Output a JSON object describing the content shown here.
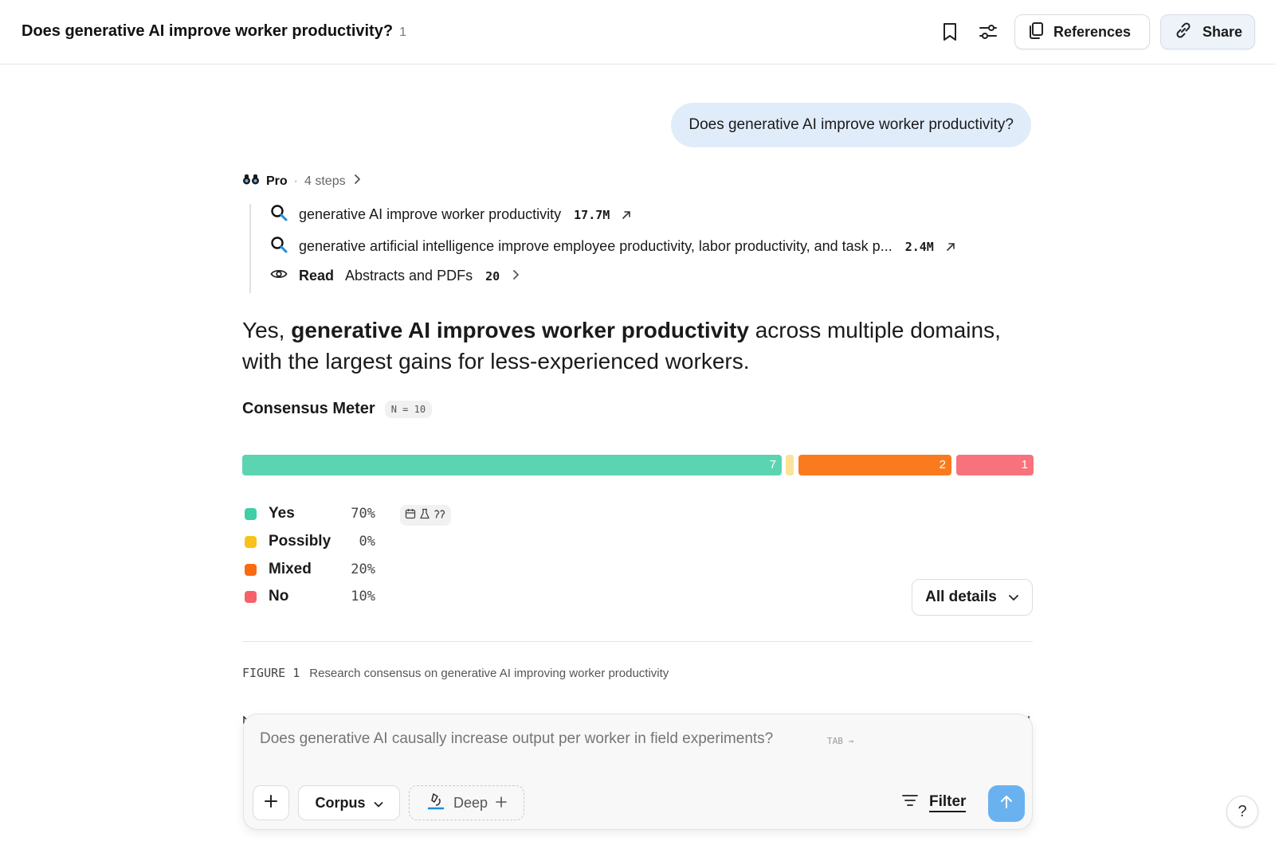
{
  "header": {
    "title": "Does generative AI improve worker productivity?",
    "title_count": "1",
    "bookmark_icon": "bookmark-icon",
    "settings_icon": "sliders-icon",
    "references_label": "References",
    "share_label": "Share"
  },
  "user_message": "Does generative AI improve worker productivity?",
  "steps": {
    "mode": "Pro",
    "separator": "·",
    "count_label": "4 steps",
    "items": [
      {
        "icon": "search-icon",
        "text": "generative AI improve worker productivity",
        "count": "17.7M"
      },
      {
        "icon": "search-icon",
        "text": "generative artificial intelligence improve employee productivity, labor productivity, and task p...",
        "count": "2.4M"
      }
    ],
    "read": {
      "icon": "eye-icon",
      "label": "Read",
      "text": "Abstracts and PDFs",
      "count": "20"
    }
  },
  "answer": {
    "prefix": "Yes, ",
    "bold": "generative AI improves worker productivity",
    "suffix": " across multiple domains, with the largest gains for less-experienced workers."
  },
  "consensus": {
    "title": "Consensus Meter",
    "n_badge": "N = 10",
    "segments": [
      {
        "label": "Yes",
        "count": "7",
        "pct": "70%",
        "color": "#5bd4b2"
      },
      {
        "label": "Possibly",
        "count": "0",
        "pct": "0%",
        "color": "#fbe39a"
      },
      {
        "label": "Mixed",
        "count": "2",
        "pct": "20%",
        "color": "#fa7a1e"
      },
      {
        "label": "No",
        "count": "1",
        "pct": "10%",
        "color": "#f7727c"
      }
    ],
    "legend_colors": [
      "#3ecfa6",
      "#f9c21a",
      "#fa6a10",
      "#f6616b"
    ],
    "all_details_label": "All details"
  },
  "figure": {
    "label": "FIGURE 1",
    "caption": "Research consensus on generative AI improving worker productivity"
  },
  "composer": {
    "placeholder": "Does generative AI causally increase output per worker in field experiments?",
    "tab_hint": "TAB →",
    "corpus_label": "Corpus",
    "deep_label": "Deep",
    "filter_label": "Filter"
  },
  "help_label": "?"
}
